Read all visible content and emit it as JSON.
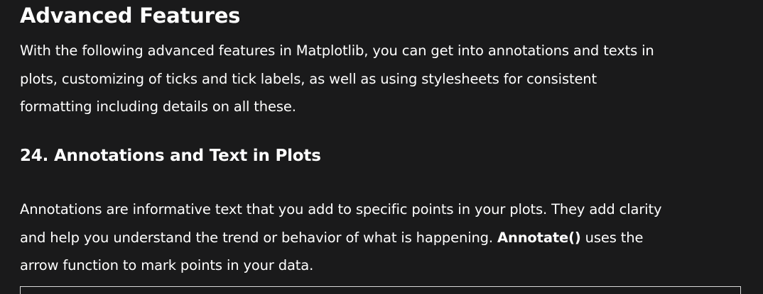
{
  "section_heading": "Advanced Features",
  "intro": {
    "line1": "With the following advanced features in Matplotlib, you can get into annotations and texts in",
    "line2": "plots, customizing of ticks and tick labels, as well as using stylesheets for consistent",
    "line3": "formatting including details on all these."
  },
  "subsection_heading": "24. Annotations and Text in Plots",
  "body": {
    "line1": "Annotations are informative text that you add to specific points in your plots. They add clarity",
    "line2_before": "and help you understand the trend or behavior of what is happening. ",
    "line2_bold": "Annotate()",
    "line2_after": " uses the",
    "line3": "arrow function to mark points in your data."
  },
  "colors": {
    "background": "#1a1a1b",
    "text": "#ffffff",
    "code_border": "#d9d9d9"
  }
}
